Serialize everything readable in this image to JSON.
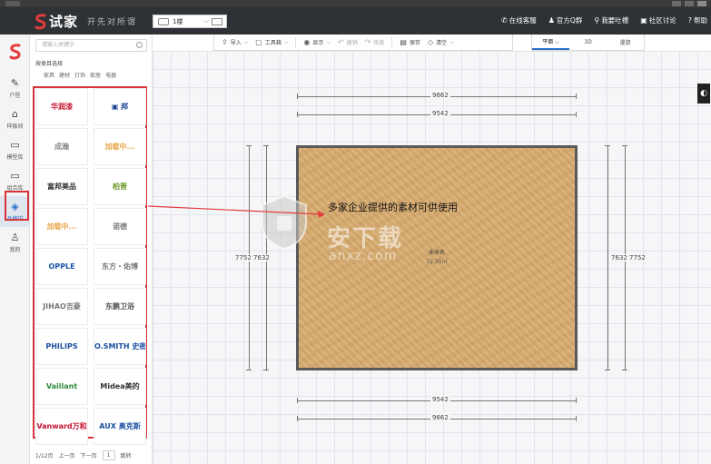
{
  "header": {
    "logo_text": "试家",
    "slogan": "开先对所谓",
    "floor_select_value": "1楼",
    "links": [
      {
        "icon": "phone-icon",
        "glyph": "✆",
        "label": "在线客服"
      },
      {
        "icon": "group-icon",
        "glyph": "♟",
        "label": "官方Q群"
      },
      {
        "icon": "mic-icon",
        "glyph": "⚲",
        "label": "我要吐槽"
      },
      {
        "icon": "forum-icon",
        "glyph": "▣",
        "label": "社区讨论"
      },
      {
        "icon": "help-icon",
        "glyph": "?",
        "label": "帮助"
      }
    ]
  },
  "rail": {
    "items": [
      {
        "name": "rail-item-floorplan",
        "icon": "pencil-icon",
        "glyph": "✎",
        "label": "户型"
      },
      {
        "name": "rail-item-samples",
        "icon": "house-icon",
        "glyph": "⌂",
        "label": "样板间"
      },
      {
        "name": "rail-item-models",
        "icon": "sofa-icon",
        "glyph": "▭",
        "label": "模型库"
      },
      {
        "name": "rail-item-combos",
        "icon": "bed-icon",
        "glyph": "▭",
        "label": "组合库"
      },
      {
        "name": "rail-item-brands",
        "icon": "brand-icon",
        "glyph": "◈",
        "label": "品牌馆",
        "active": true
      },
      {
        "name": "rail-item-mine",
        "icon": "user-icon",
        "glyph": "♙",
        "label": "我的"
      }
    ]
  },
  "panel": {
    "search_placeholder": "请输入关键字",
    "filter_title": "按类目选择",
    "categories": [
      "家具",
      "建材",
      "灯饰",
      "家居",
      "电器"
    ],
    "brands": [
      {
        "text": "华润漆",
        "color": "#c8102e"
      },
      {
        "text": "▣ 邦",
        "color": "#1b3f8f"
      },
      {
        "text": "成瀚",
        "color": "#888888"
      },
      {
        "text": "加载中...",
        "color": "#e8a64a"
      },
      {
        "text": "富邦美品",
        "color": "#333333"
      },
      {
        "text": "柏晋",
        "color": "#6a9a2a"
      },
      {
        "text": "加载中...",
        "color": "#e8a64a"
      },
      {
        "text": "诺德",
        "color": "#7a7a7a"
      },
      {
        "text": "OPPLE",
        "color": "#1a56a8"
      },
      {
        "text": "东方・佑博",
        "color": "#777777"
      },
      {
        "text": "JIHAO吉豪",
        "color": "#777777"
      },
      {
        "text": "东鹏卫浴",
        "color": "#555555"
      },
      {
        "text": "PHILIPS",
        "color": "#1a4fa0"
      },
      {
        "text": "A.O.SMITH 史密斯",
        "color": "#1a4fa0"
      },
      {
        "text": "Vaillant",
        "color": "#2e8b3a"
      },
      {
        "text": "Midea美的",
        "color": "#333333"
      },
      {
        "text": "Vanward万和",
        "color": "#c8102e"
      },
      {
        "text": "AUX 奥克斯",
        "color": "#1a4fa0"
      }
    ],
    "pager": {
      "page_info": "1/12页",
      "prev": "上一页",
      "next": "下一页",
      "input_value": "1",
      "go": "跳转"
    }
  },
  "toolbar": {
    "items": [
      {
        "name": "import-button",
        "icon": "upload-icon",
        "glyph": "⇪",
        "label": "导入",
        "caret": true,
        "disabled": false
      },
      {
        "name": "toolbox-button",
        "icon": "toolbox-icon",
        "glyph": "▢",
        "label": "工具箱",
        "caret": true,
        "disabled": false
      },
      {
        "name": "display-button",
        "icon": "eye-icon",
        "glyph": "◉",
        "label": "显示",
        "caret": true,
        "disabled": false
      },
      {
        "name": "undo-button",
        "icon": "undo-icon",
        "glyph": "↶",
        "label": "撤销",
        "caret": false,
        "disabled": true
      },
      {
        "name": "redo-button",
        "icon": "redo-icon",
        "glyph": "↷",
        "label": "恢复",
        "caret": false,
        "disabled": true
      },
      {
        "name": "save-button",
        "icon": "save-icon",
        "glyph": "▤",
        "label": "保存",
        "caret": false,
        "disabled": false
      },
      {
        "name": "clear-button",
        "icon": "eraser-icon",
        "glyph": "◇",
        "label": "清空",
        "caret": true,
        "disabled": false
      }
    ]
  },
  "view_tabs": [
    {
      "name": "tab-2d",
      "label": "平面 ⌵",
      "active": true
    },
    {
      "name": "tab-3d",
      "label": "3D",
      "active": false
    },
    {
      "name": "tab-walk",
      "label": "漫游",
      "active": false
    }
  ],
  "canvas": {
    "annotation": "多家企业提供的素材可供使用",
    "room_label": "未命名",
    "room_area": "72.35㎡",
    "dim_top_outer": "9662",
    "dim_top_inner": "9542",
    "dim_bottom_inner": "9542",
    "dim_bottom_outer": "9662",
    "dim_left": "7752 7632",
    "dim_right": "7632 7752"
  },
  "watermark": {
    "text": "安下载",
    "sub": "anxz.com"
  },
  "colors": {
    "header_bg": "#2e3135",
    "accent": "#2a72c8",
    "highlight_red": "#d6343a",
    "floor_tile": "#d9ae72"
  }
}
